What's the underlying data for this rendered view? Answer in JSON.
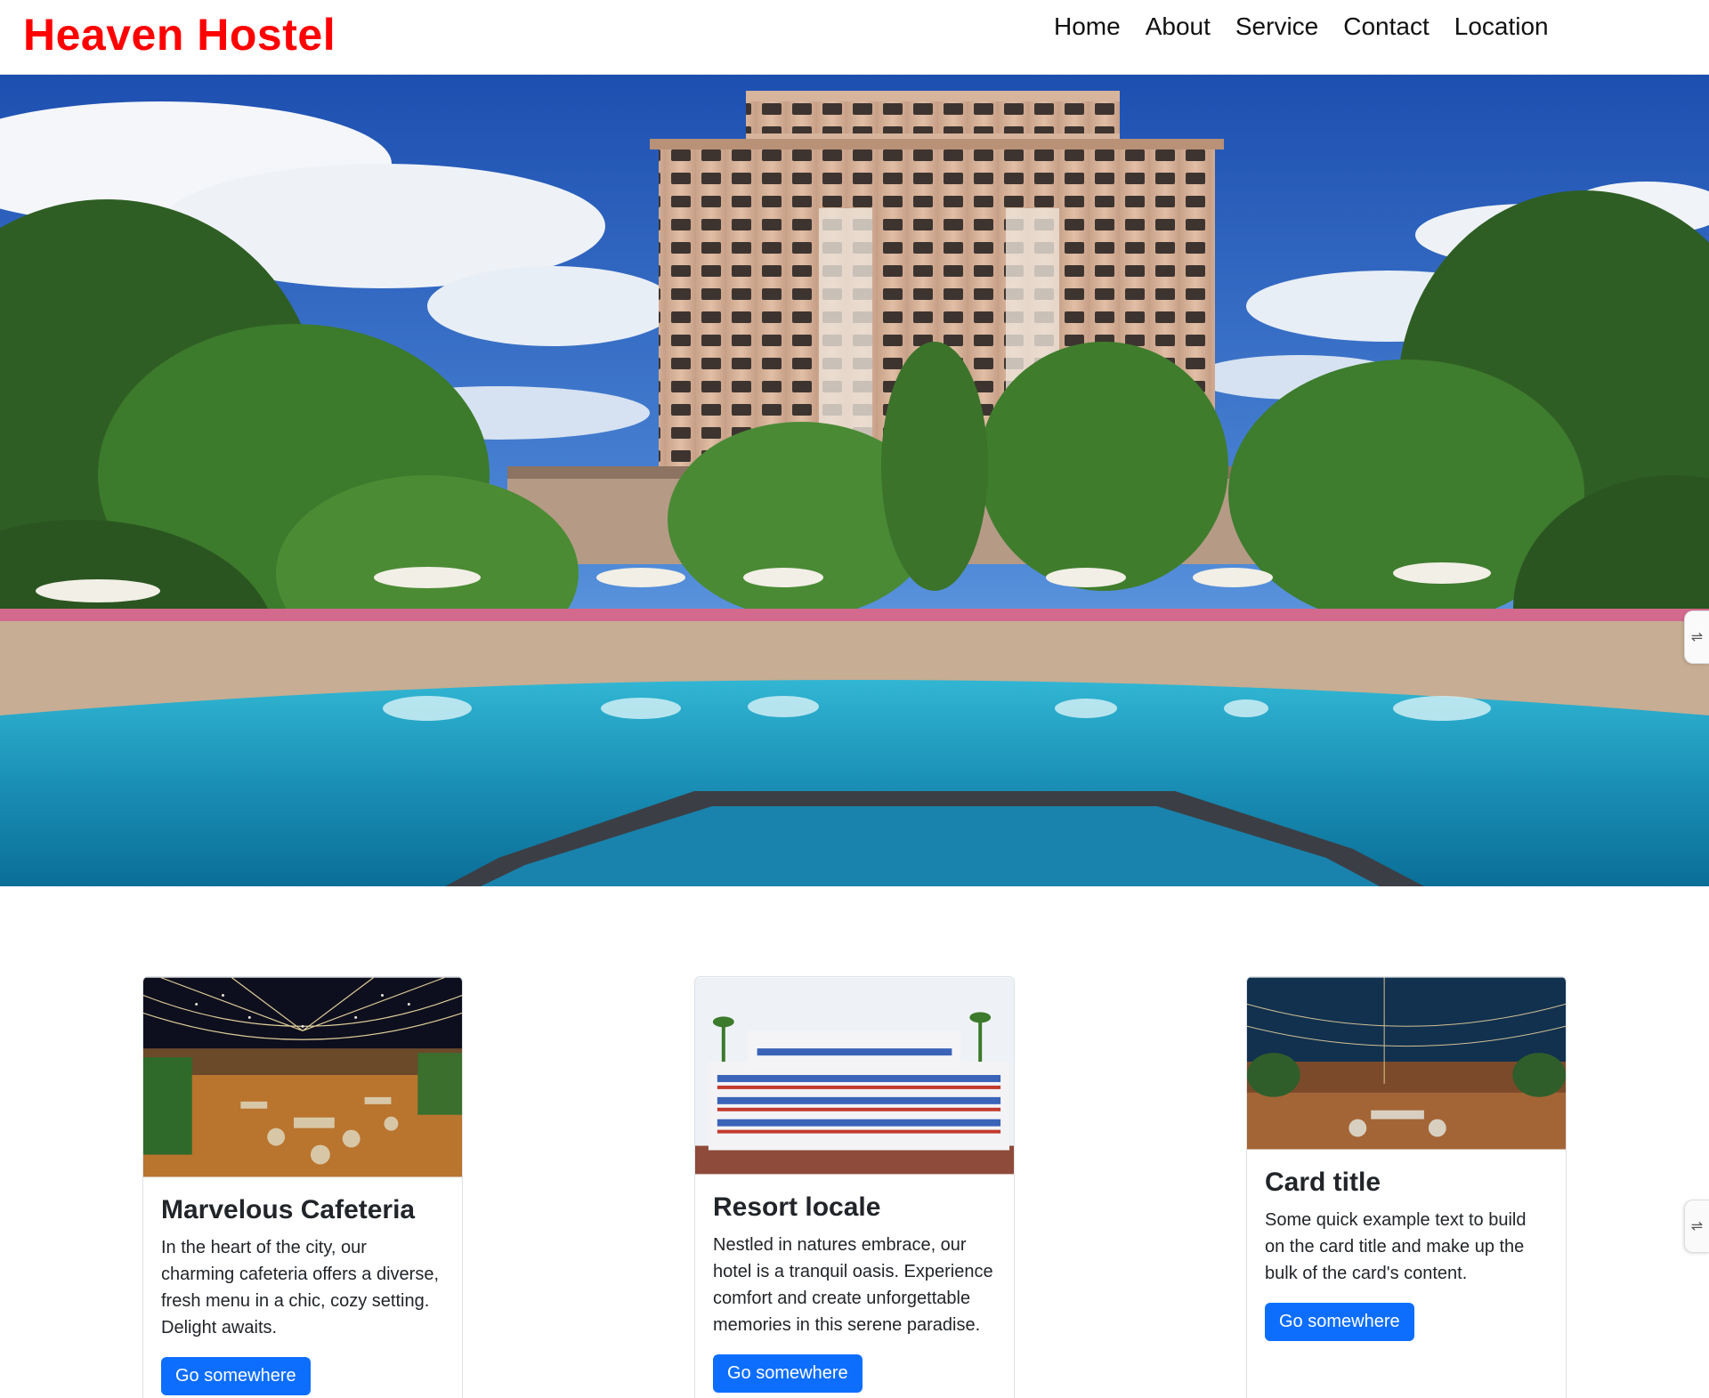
{
  "header": {
    "brand": "Heaven Hostel",
    "nav": [
      "Home",
      "About",
      "Service",
      "Contact",
      "Location"
    ]
  },
  "hero": {
    "icon": "hotel-pool-photo"
  },
  "cards": [
    {
      "title": "Marvelous Cafeteria",
      "text": "In the heart of the city, our charming cafeteria offers a diverse, fresh menu in a chic, cozy setting. Delight awaits.",
      "button": "Go somewhere"
    },
    {
      "title": "Resort locale",
      "text": "Nestled in natures embrace, our hotel is a tranquil oasis. Experience comfort and create unforgettable memories in this serene paradise.",
      "button": "Go somewhere"
    },
    {
      "title": "Card title",
      "text": "Some quick example text to build on the card title and make up the bulk of the card's content.",
      "button": "Go somewhere"
    }
  ],
  "colors": {
    "brand": "#ff0000",
    "button": "#0d6efd"
  }
}
